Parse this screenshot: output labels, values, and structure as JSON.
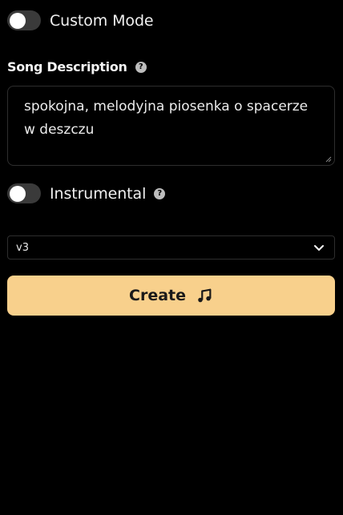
{
  "custom_mode": {
    "label": "Custom Mode",
    "enabled": false
  },
  "song_description": {
    "label": "Song Description",
    "help_icon": "question-circle-icon",
    "value": "spokojna, melodyjna piosenka o spacerze w deszczu"
  },
  "instrumental": {
    "label": "Instrumental",
    "help_icon": "question-circle-icon",
    "enabled": false
  },
  "model_select": {
    "selected": "v3",
    "icon": "chevron-down-icon"
  },
  "create_button": {
    "label": "Create",
    "icon": "music-note-icon",
    "color": "#f8d08c"
  }
}
